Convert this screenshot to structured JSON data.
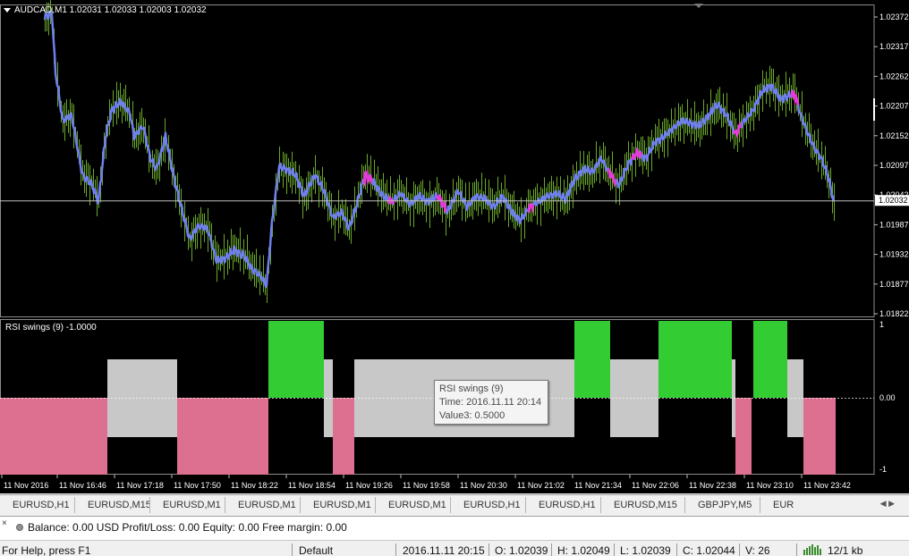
{
  "chart": {
    "header": "AUDCAD,M1  1.02031 1.02033 1.02003 1.02032",
    "current_price": "1.02032",
    "price_axis": [
      "1.02372",
      "1.02317",
      "1.02262",
      "1.02207",
      "1.02152",
      "1.02097",
      "1.02042",
      "1.01987",
      "1.01932",
      "1.01877",
      "1.01822"
    ],
    "time_axis": [
      "11 Nov 2016",
      "11 Nov 16:46",
      "11 Nov 17:18",
      "11 Nov 17:50",
      "11 Nov 18:22",
      "11 Nov 18:54",
      "11 Nov 19:26",
      "11 Nov 19:58",
      "11 Nov 20:30",
      "11 Nov 21:02",
      "11 Nov 21:34",
      "11 Nov 22:06",
      "11 Nov 22:38",
      "11 Nov 23:10",
      "11 Nov 23:42"
    ],
    "colors": {
      "background": "#000000",
      "bars": "#6aa82a",
      "line": "#6f7ff0",
      "swing": "#e63ad8",
      "up": "#33cc33",
      "neutral": "#c8c8c8",
      "down": "#dd7090"
    }
  },
  "indicator": {
    "header": "RSI swings (9) -1.0000",
    "axis": [
      "1",
      "0.00",
      "-1"
    ]
  },
  "tooltip": {
    "line1": "RSI swings (9)",
    "line2": "Time: 2016.11.11 20:14",
    "line3": "Value3: 0.5000"
  },
  "tabs": [
    "EURUSD,H1",
    "EURUSD,M15",
    "EURUSD,M1",
    "EURUSD,M1",
    "EURUSD,M1",
    "EURUSD,M1",
    "EURUSD,H1",
    "EURUSD,H1",
    "EURUSD,M15",
    "GBPJPY,M5",
    "EUR"
  ],
  "terminal": {
    "close_icon": "×",
    "text": "Balance: 0.00 USD  Profit/Loss: 0.00  Equity: 0.00  Free margin: 0.00"
  },
  "status": {
    "help": "For Help, press F1",
    "profile": "Default",
    "datetime": "2016.11.11 20:15",
    "open": "O: 1.02039",
    "high": "H: 1.02049",
    "low": "L: 1.02039",
    "close": "C: 1.02044",
    "volume": "V: 26",
    "connection": "12/1 kb"
  },
  "chart_data": [
    {
      "type": "line",
      "title": "AUDCAD,M1",
      "x": [
        "11 Nov 2016",
        "11 Nov 16:46",
        "11 Nov 17:18",
        "11 Nov 17:50",
        "11 Nov 18:22",
        "11 Nov 18:54",
        "11 Nov 19:26",
        "11 Nov 19:58",
        "11 Nov 20:30",
        "11 Nov 21:02",
        "11 Nov 21:34",
        "11 Nov 22:06",
        "11 Nov 22:38",
        "11 Nov 23:10",
        "11 Nov 23:42"
      ],
      "series": [
        {
          "values": [
            1.02372,
            1.0213,
            1.02225,
            1.01985,
            1.01872,
            1.0206,
            1.0205,
            1.0206,
            1.0201,
            1.02055,
            1.0211,
            1.0215,
            1.0219,
            1.02232,
            1.02025
          ]
        }
      ],
      "ylim": [
        1.01822,
        1.02372
      ]
    },
    {
      "type": "bar",
      "title": "RSI swings (9) -1.0000",
      "segments": [
        {
          "from": 0,
          "to": 120,
          "value": -1
        },
        {
          "from": 120,
          "to": 198,
          "value": 0.5
        },
        {
          "from": 198,
          "to": 300,
          "value": -1
        },
        {
          "from": 300,
          "to": 362,
          "value": 1
        },
        {
          "from": 362,
          "to": 372,
          "value": 0.5
        },
        {
          "from": 372,
          "to": 396,
          "value": -1
        },
        {
          "from": 396,
          "to": 642,
          "value": 0.5
        },
        {
          "from": 642,
          "to": 682,
          "value": 1
        },
        {
          "from": 682,
          "to": 736,
          "value": 0.5
        },
        {
          "from": 736,
          "to": 818,
          "value": 1
        },
        {
          "from": 818,
          "to": 822,
          "value": 0.5
        },
        {
          "from": 822,
          "to": 840,
          "value": -1
        },
        {
          "from": 842,
          "to": 880,
          "value": 1
        },
        {
          "from": 880,
          "to": 898,
          "value": 0.5
        },
        {
          "from": 898,
          "to": 934,
          "value": -1
        }
      ],
      "ylim": [
        -1,
        1
      ]
    }
  ]
}
